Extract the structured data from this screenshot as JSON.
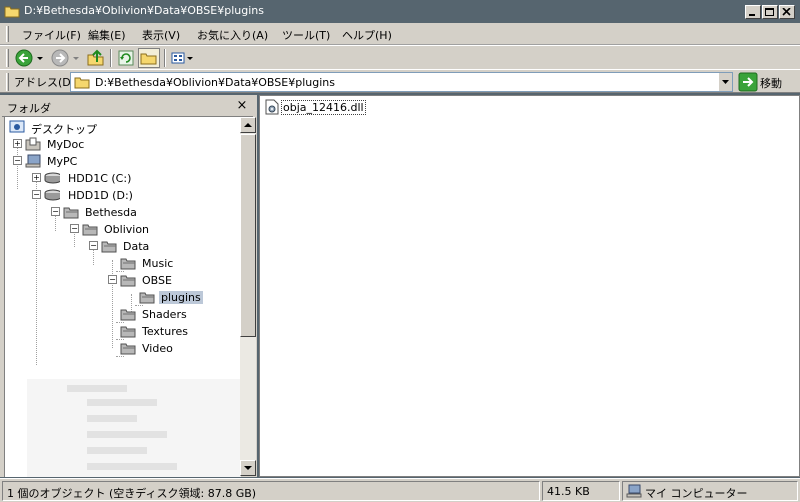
{
  "window": {
    "title": "D:¥Bethesda¥Oblivion¥Data¥OBSE¥plugins"
  },
  "menu": {
    "items": [
      {
        "label": "ファイル(F)"
      },
      {
        "label": "編集(E)"
      },
      {
        "label": "表示(V)"
      },
      {
        "label": "お気に入り(A)"
      },
      {
        "label": "ツール(T)"
      },
      {
        "label": "ヘルプ(H)"
      }
    ]
  },
  "address": {
    "label": "アドレス(D)",
    "value": "D:¥Bethesda¥Oblivion¥Data¥OBSE¥plugins",
    "go_label": "移動"
  },
  "folders": {
    "title": "フォルダ",
    "close_glyph": "×",
    "tree": [
      {
        "label": "デスクトップ"
      },
      {
        "label": "MyDoc"
      },
      {
        "label": "MyPC"
      },
      {
        "label": "HDD1C (C:)"
      },
      {
        "label": "HDD1D (D:)"
      },
      {
        "label": "Bethesda"
      },
      {
        "label": "Oblivion"
      },
      {
        "label": "Data"
      },
      {
        "label": "Music"
      },
      {
        "label": "OBSE"
      },
      {
        "label": "plugins",
        "selected": true
      },
      {
        "label": "Shaders"
      },
      {
        "label": "Textures"
      },
      {
        "label": "Video"
      }
    ]
  },
  "files": [
    {
      "name": "obja_12416.dll"
    }
  ],
  "status": {
    "objects": "1 個のオブジェクト (空きディスク領域: 87.8 GB)",
    "size": "41.5 KB",
    "zone": "マイ コンピューター"
  },
  "colors": {
    "titlebar": "#56656f",
    "face": "#d4d0c8",
    "selection": "#bcc8d8"
  }
}
